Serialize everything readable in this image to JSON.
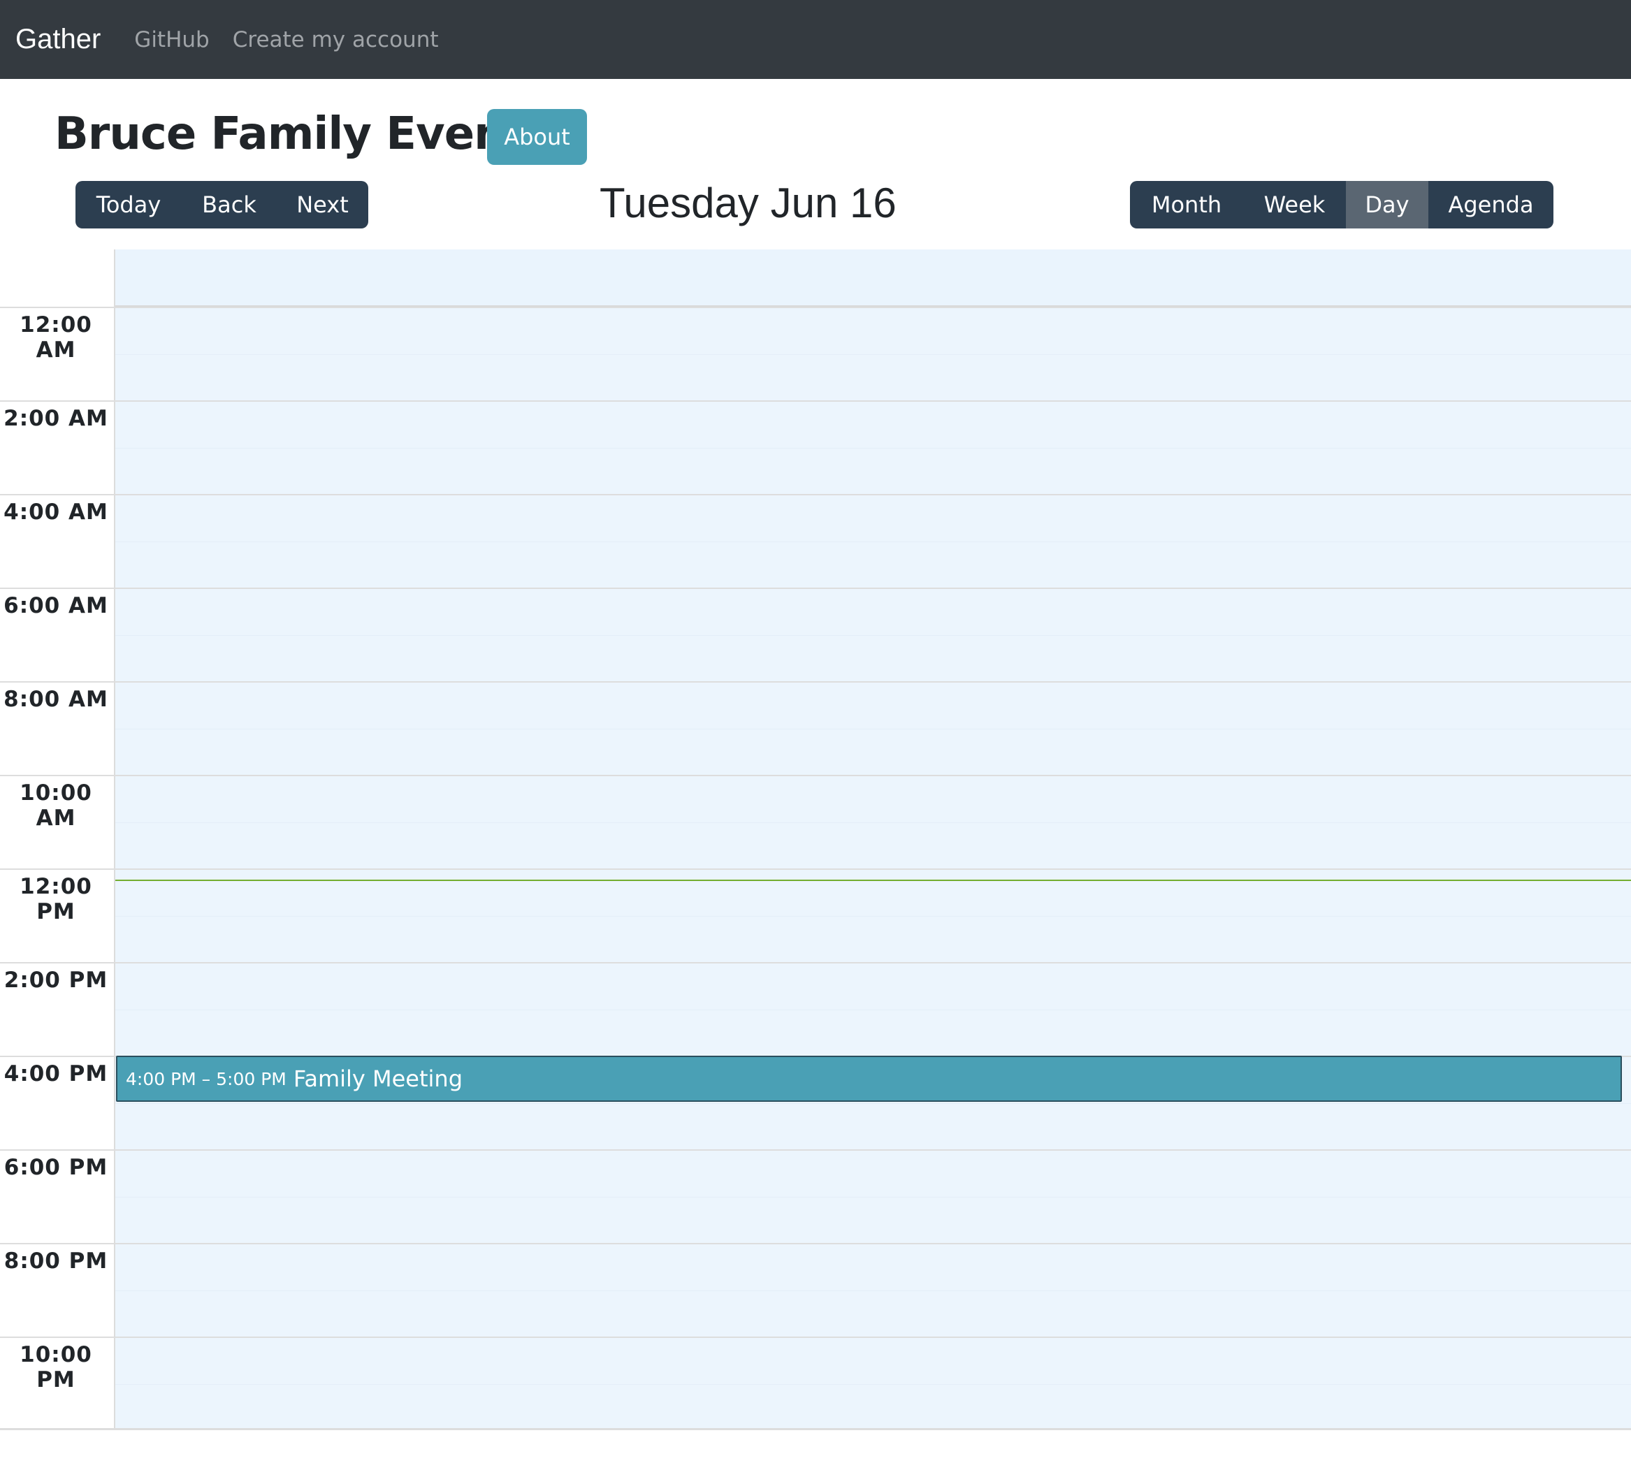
{
  "navbar": {
    "brand": "Gather",
    "links": [
      "GitHub",
      "Create my account"
    ]
  },
  "page": {
    "title": "Bruce Family Events",
    "about_label": "About"
  },
  "toolbar": {
    "nav_buttons": [
      "Today",
      "Back",
      "Next"
    ],
    "date_label": "Tuesday Jun 16",
    "view_buttons": [
      "Month",
      "Week",
      "Day",
      "Agenda"
    ],
    "active_view": "Day"
  },
  "calendar": {
    "time_labels": [
      "12:00 AM",
      "2:00 AM",
      "4:00 AM",
      "6:00 AM",
      "8:00 AM",
      "10:00 AM",
      "12:00 PM",
      "2:00 PM",
      "4:00 PM",
      "6:00 PM",
      "8:00 PM",
      "10:00 PM"
    ],
    "event": {
      "time": "4:00 PM – 5:00 PM",
      "title": "Family Meeting"
    }
  },
  "colors": {
    "navbar_bg": "#343a40",
    "accent": "#4aa0b5",
    "button_group_bg": "#2c3e50",
    "active_button_bg": "#5a6672",
    "day_bg": "#ecf5fd",
    "now_line": "#74ad31"
  }
}
